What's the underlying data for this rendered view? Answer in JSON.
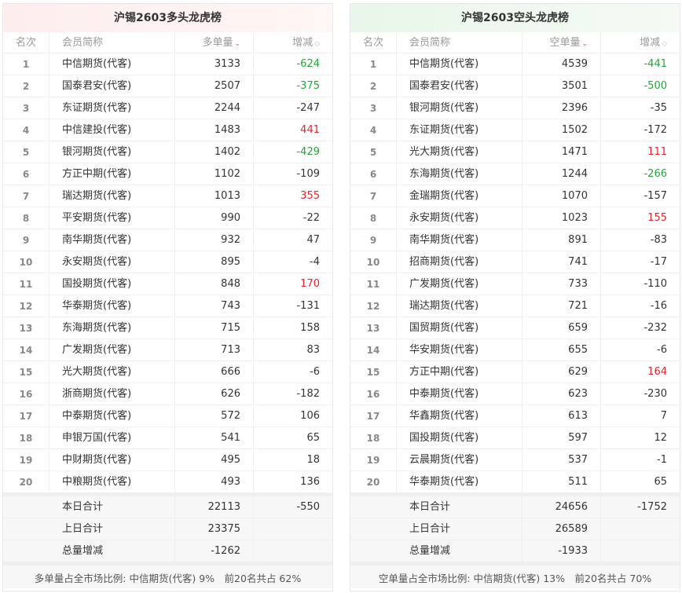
{
  "colors": {
    "up": "#e8222b",
    "down": "#22a538",
    "sort_active": "#f05a28"
  },
  "panels": [
    {
      "title": "沪锡2603多头龙虎榜",
      "headers": [
        "名次",
        "会员简称",
        "多单量",
        "增减"
      ],
      "sort_icon": "sort-caret-icon",
      "rows": [
        [
          "1",
          "中信期货(代客)",
          "3133",
          "-624",
          "down"
        ],
        [
          "2",
          "国泰君安(代客)",
          "2507",
          "-375",
          "down"
        ],
        [
          "3",
          "东证期货(代客)",
          "2244",
          "-247",
          ""
        ],
        [
          "4",
          "中信建投(代客)",
          "1483",
          "441",
          "up"
        ],
        [
          "5",
          "银河期货(代客)",
          "1402",
          "-429",
          "down"
        ],
        [
          "6",
          "方正中期(代客)",
          "1102",
          "-109",
          ""
        ],
        [
          "7",
          "瑞达期货(代客)",
          "1013",
          "355",
          "up"
        ],
        [
          "8",
          "平安期货(代客)",
          "990",
          "-22",
          ""
        ],
        [
          "9",
          "南华期货(代客)",
          "932",
          "47",
          ""
        ],
        [
          "10",
          "永安期货(代客)",
          "895",
          "-4",
          ""
        ],
        [
          "11",
          "国投期货(代客)",
          "848",
          "170",
          "up"
        ],
        [
          "12",
          "华泰期货(代客)",
          "743",
          "-131",
          ""
        ],
        [
          "13",
          "东海期货(代客)",
          "715",
          "158",
          ""
        ],
        [
          "14",
          "广发期货(代客)",
          "713",
          "83",
          ""
        ],
        [
          "15",
          "光大期货(代客)",
          "666",
          "-6",
          ""
        ],
        [
          "16",
          "浙商期货(代客)",
          "626",
          "-182",
          ""
        ],
        [
          "17",
          "中泰期货(代客)",
          "572",
          "106",
          ""
        ],
        [
          "18",
          "申银万国(代客)",
          "541",
          "65",
          ""
        ],
        [
          "19",
          "中财期货(代客)",
          "495",
          "18",
          ""
        ],
        [
          "20",
          "中粮期货(代客)",
          "493",
          "136",
          ""
        ]
      ],
      "summary": [
        [
          "本日合计",
          "22113",
          "-550"
        ],
        [
          "上日合计",
          "23375",
          ""
        ],
        [
          "总量增减",
          "-1262",
          ""
        ]
      ],
      "footer": "多单量占全市场比例: 中信期货(代客) 9%　前20名共占 62%"
    },
    {
      "title": "沪锡2603空头龙虎榜",
      "headers": [
        "名次",
        "会员简称",
        "空单量",
        "增减"
      ],
      "sort_icon": "sort-caret-icon",
      "rows": [
        [
          "1",
          "中信期货(代客)",
          "4539",
          "-441",
          "down"
        ],
        [
          "2",
          "国泰君安(代客)",
          "3501",
          "-500",
          "down"
        ],
        [
          "3",
          "银河期货(代客)",
          "2396",
          "-35",
          ""
        ],
        [
          "4",
          "东证期货(代客)",
          "1502",
          "-172",
          ""
        ],
        [
          "5",
          "光大期货(代客)",
          "1471",
          "111",
          "up"
        ],
        [
          "6",
          "东海期货(代客)",
          "1244",
          "-266",
          "down"
        ],
        [
          "7",
          "金瑞期货(代客)",
          "1070",
          "-157",
          ""
        ],
        [
          "8",
          "永安期货(代客)",
          "1023",
          "155",
          "up"
        ],
        [
          "9",
          "南华期货(代客)",
          "891",
          "-83",
          ""
        ],
        [
          "10",
          "招商期货(代客)",
          "741",
          "-17",
          ""
        ],
        [
          "11",
          "广发期货(代客)",
          "733",
          "-110",
          ""
        ],
        [
          "12",
          "瑞达期货(代客)",
          "721",
          "-16",
          ""
        ],
        [
          "13",
          "国贸期货(代客)",
          "659",
          "-232",
          ""
        ],
        [
          "14",
          "华安期货(代客)",
          "655",
          "-6",
          ""
        ],
        [
          "15",
          "方正中期(代客)",
          "629",
          "164",
          "up"
        ],
        [
          "16",
          "中泰期货(代客)",
          "623",
          "-230",
          ""
        ],
        [
          "17",
          "华鑫期货(代客)",
          "613",
          "7",
          ""
        ],
        [
          "18",
          "国投期货(代客)",
          "597",
          "12",
          ""
        ],
        [
          "19",
          "云晨期货(代客)",
          "537",
          "-1",
          ""
        ],
        [
          "20",
          "华泰期货(代客)",
          "511",
          "65",
          ""
        ]
      ],
      "summary": [
        [
          "本日合计",
          "24656",
          "-1752"
        ],
        [
          "上日合计",
          "26589",
          ""
        ],
        [
          "总量增减",
          "-1933",
          ""
        ]
      ],
      "footer": "空单量占全市场比例: 中信期货(代客) 13%　前20名共占 70%"
    }
  ]
}
